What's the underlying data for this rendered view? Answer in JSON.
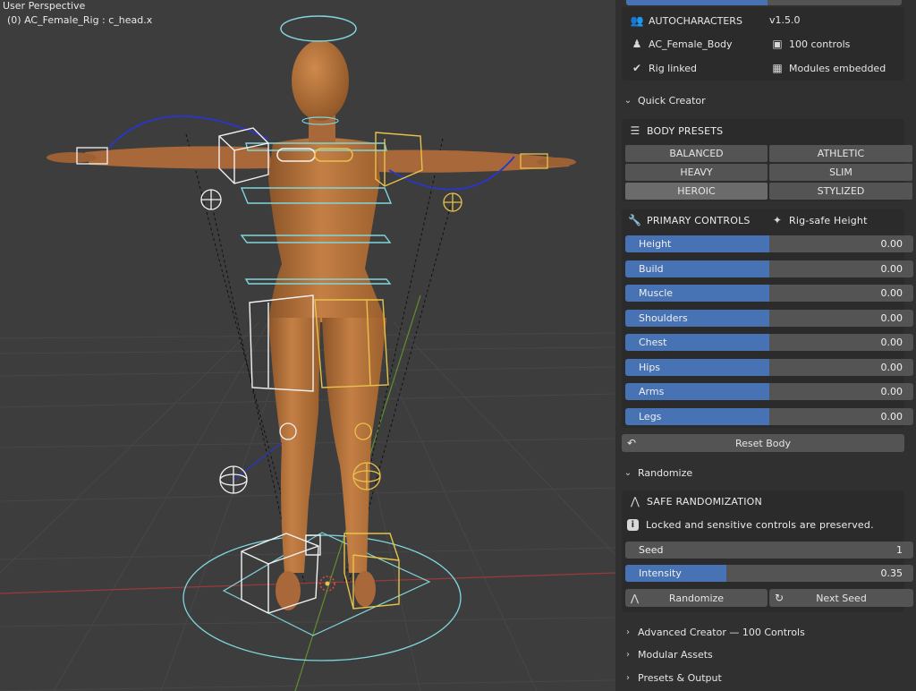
{
  "viewport": {
    "perspective_label": "User Perspective",
    "object_label": "(0) AC_Female_Rig : c_head.x"
  },
  "addon": {
    "name": "AUTOCHARACTERS",
    "version": "v1.5.0",
    "body_name": "AC_Female_Body",
    "controls_count": "100 controls",
    "rig_status": "Rig linked",
    "modules_status": "Modules embedded"
  },
  "quick_creator": {
    "label": "Quick Creator",
    "body_presets_title": "BODY PRESETS",
    "presets": [
      "BALANCED",
      "ATHLETIC",
      "HEAVY",
      "SLIM",
      "HEROIC",
      "STYLIZED"
    ],
    "active_preset": "HEROIC",
    "primary_controls_title": "PRIMARY CONTROLS",
    "rig_safe_label": "Rig-safe Height",
    "sliders": [
      {
        "label": "Height",
        "value": "0.00"
      },
      {
        "label": "Build",
        "value": "0.00"
      },
      {
        "label": "Muscle",
        "value": "0.00"
      },
      {
        "label": "Shoulders",
        "value": "0.00"
      },
      {
        "label": "Chest",
        "value": "0.00"
      },
      {
        "label": "Hips",
        "value": "0.00"
      },
      {
        "label": "Arms",
        "value": "0.00"
      },
      {
        "label": "Legs",
        "value": "0.00"
      }
    ],
    "slider_fill_fraction": 0.5,
    "reset_label": "Reset Body"
  },
  "randomize": {
    "label": "Randomize",
    "safe_title": "SAFE RANDOMIZATION",
    "note": "Locked and sensitive controls are preserved.",
    "seed_label": "Seed",
    "seed_value": "1",
    "intensity_label": "Intensity",
    "intensity_value": "0.35",
    "intensity_fraction": 0.35,
    "randomize_button": "Randomize",
    "next_seed_button": "Next Seed"
  },
  "collapsed_sections": [
    "Advanced Creator — 100 Controls",
    "Modular Assets",
    "Presets & Output"
  ],
  "colors": {
    "accent": "#4772b3",
    "viewport_bg": "#3d3d3d",
    "panel_bg": "#303030",
    "skin": "#b8743e",
    "rig_white": "#f2f2f2",
    "rig_yellow": "#e8c24a",
    "rig_cyan": "#7fd6dc",
    "rig_blue": "#2a36c8"
  },
  "icons": {
    "addon": "users-icon",
    "body": "person-icon",
    "controls": "cube-icon",
    "rig": "check-icon",
    "modules": "modules-icon",
    "presets": "list-icon",
    "controls_section": "wrench-icon",
    "rig_safe": "armature-icon",
    "reset": "undo-icon",
    "safe_random": "curve-icon",
    "info": "info-icon",
    "next_seed": "refresh-icon"
  }
}
